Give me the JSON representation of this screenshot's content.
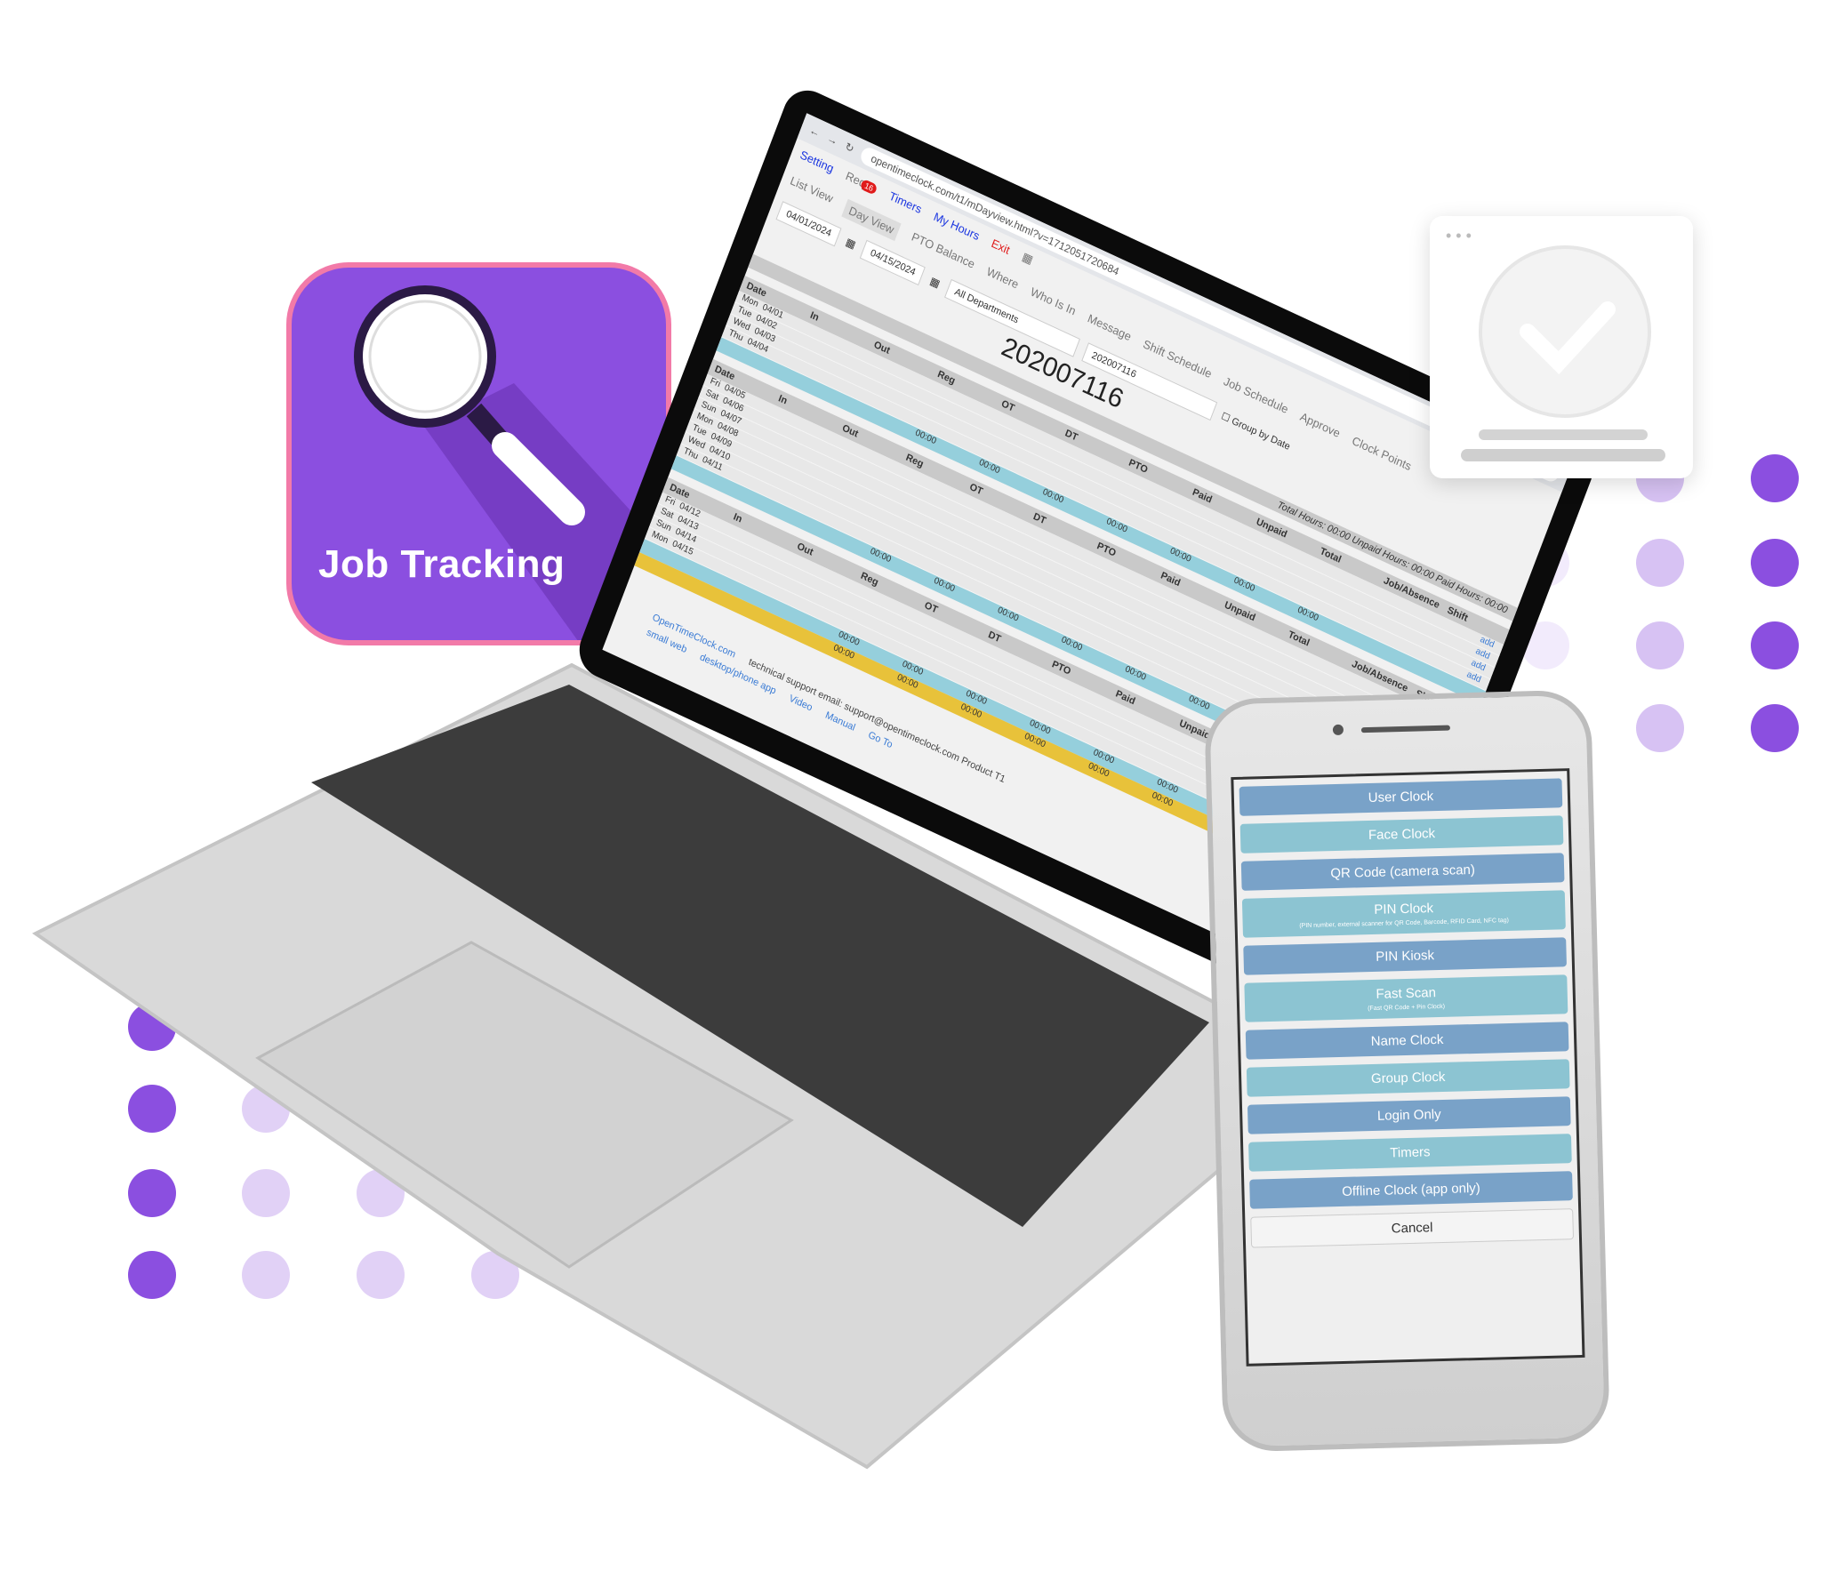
{
  "brand": {
    "tile_title": "Job Tracking",
    "tile_icon": "magnifier-icon",
    "purple": "#8b4fe0",
    "pink": "#f27aa8"
  },
  "browser": {
    "url": "opentimeclock.com/t1/mDayview.html?v=1712051720684"
  },
  "nav": {
    "setting": "Setting",
    "req": "Req",
    "req_badge": "16",
    "timers": "Timers",
    "my_hours": "My Hours",
    "exit": "Exit",
    "tabs": [
      "List View",
      "Day View",
      "PTO Balance",
      "Where",
      "Who Is In",
      "Message",
      "Shift Schedule",
      "Job Schedule",
      "Approve",
      "Clock Points"
    ]
  },
  "filters": {
    "start_date": "04/01/2024",
    "end_date": "04/15/2024",
    "department": "All Departments",
    "employee": "202007116",
    "group_by_date": "Group by Date"
  },
  "employee_id": "202007116",
  "columns": [
    "Date",
    "In",
    "Out",
    "Reg",
    "OT",
    "DT",
    "PTO",
    "Paid",
    "Unpaid",
    "Total",
    "Job/Absence",
    "Shift"
  ],
  "totals_text": "Total Hours: 00:00 Unpaid Hours: 00:00 Paid Hours: 00:00",
  "weeks": [
    {
      "rows": [
        [
          "Mon",
          "04/01"
        ],
        [
          "Tue",
          "04/02"
        ],
        [
          "Wed",
          "04/03"
        ],
        [
          "Thu",
          "04/04"
        ]
      ]
    },
    {
      "rows": [
        [
          "Fri",
          "04/05"
        ],
        [
          "Sat",
          "04/06"
        ],
        [
          "Sun",
          "04/07"
        ],
        [
          "Mon",
          "04/08"
        ],
        [
          "Tue",
          "04/09"
        ],
        [
          "Wed",
          "04/10"
        ],
        [
          "Thu",
          "04/11"
        ]
      ]
    },
    {
      "rows": [
        [
          "Fri",
          "04/12"
        ],
        [
          "Sat",
          "04/13"
        ],
        [
          "Sun",
          "04/14"
        ],
        [
          "Mon",
          "04/15"
        ]
      ]
    }
  ],
  "zero": "00:00",
  "add": "add",
  "footer": {
    "site": "OpenTimeClock.com",
    "support": "technical support email: support@opentimeclock.com Product T1",
    "small_web": "small web",
    "app": "desktop/phone app",
    "video": "Video",
    "manual": "Manual",
    "goto": "Go To"
  },
  "phone": {
    "buttons": [
      {
        "label": "User Clock"
      },
      {
        "label": "Face Clock"
      },
      {
        "label": "QR Code (camera scan)"
      },
      {
        "label": "PIN Clock",
        "sub": "(PIN number, external scanner for QR Code, Barcode, RFID Card, NFC tag)"
      },
      {
        "label": "PIN Kiosk"
      },
      {
        "label": "Fast Scan",
        "sub": "(Fast QR Code + Pin Clock)"
      },
      {
        "label": "Name Clock"
      },
      {
        "label": "Group Clock"
      },
      {
        "label": "Login Only"
      },
      {
        "label": "Timers"
      },
      {
        "label": "Offline Clock (app only)"
      }
    ],
    "cancel": "Cancel"
  },
  "card": {
    "icon": "checkmark-icon"
  }
}
